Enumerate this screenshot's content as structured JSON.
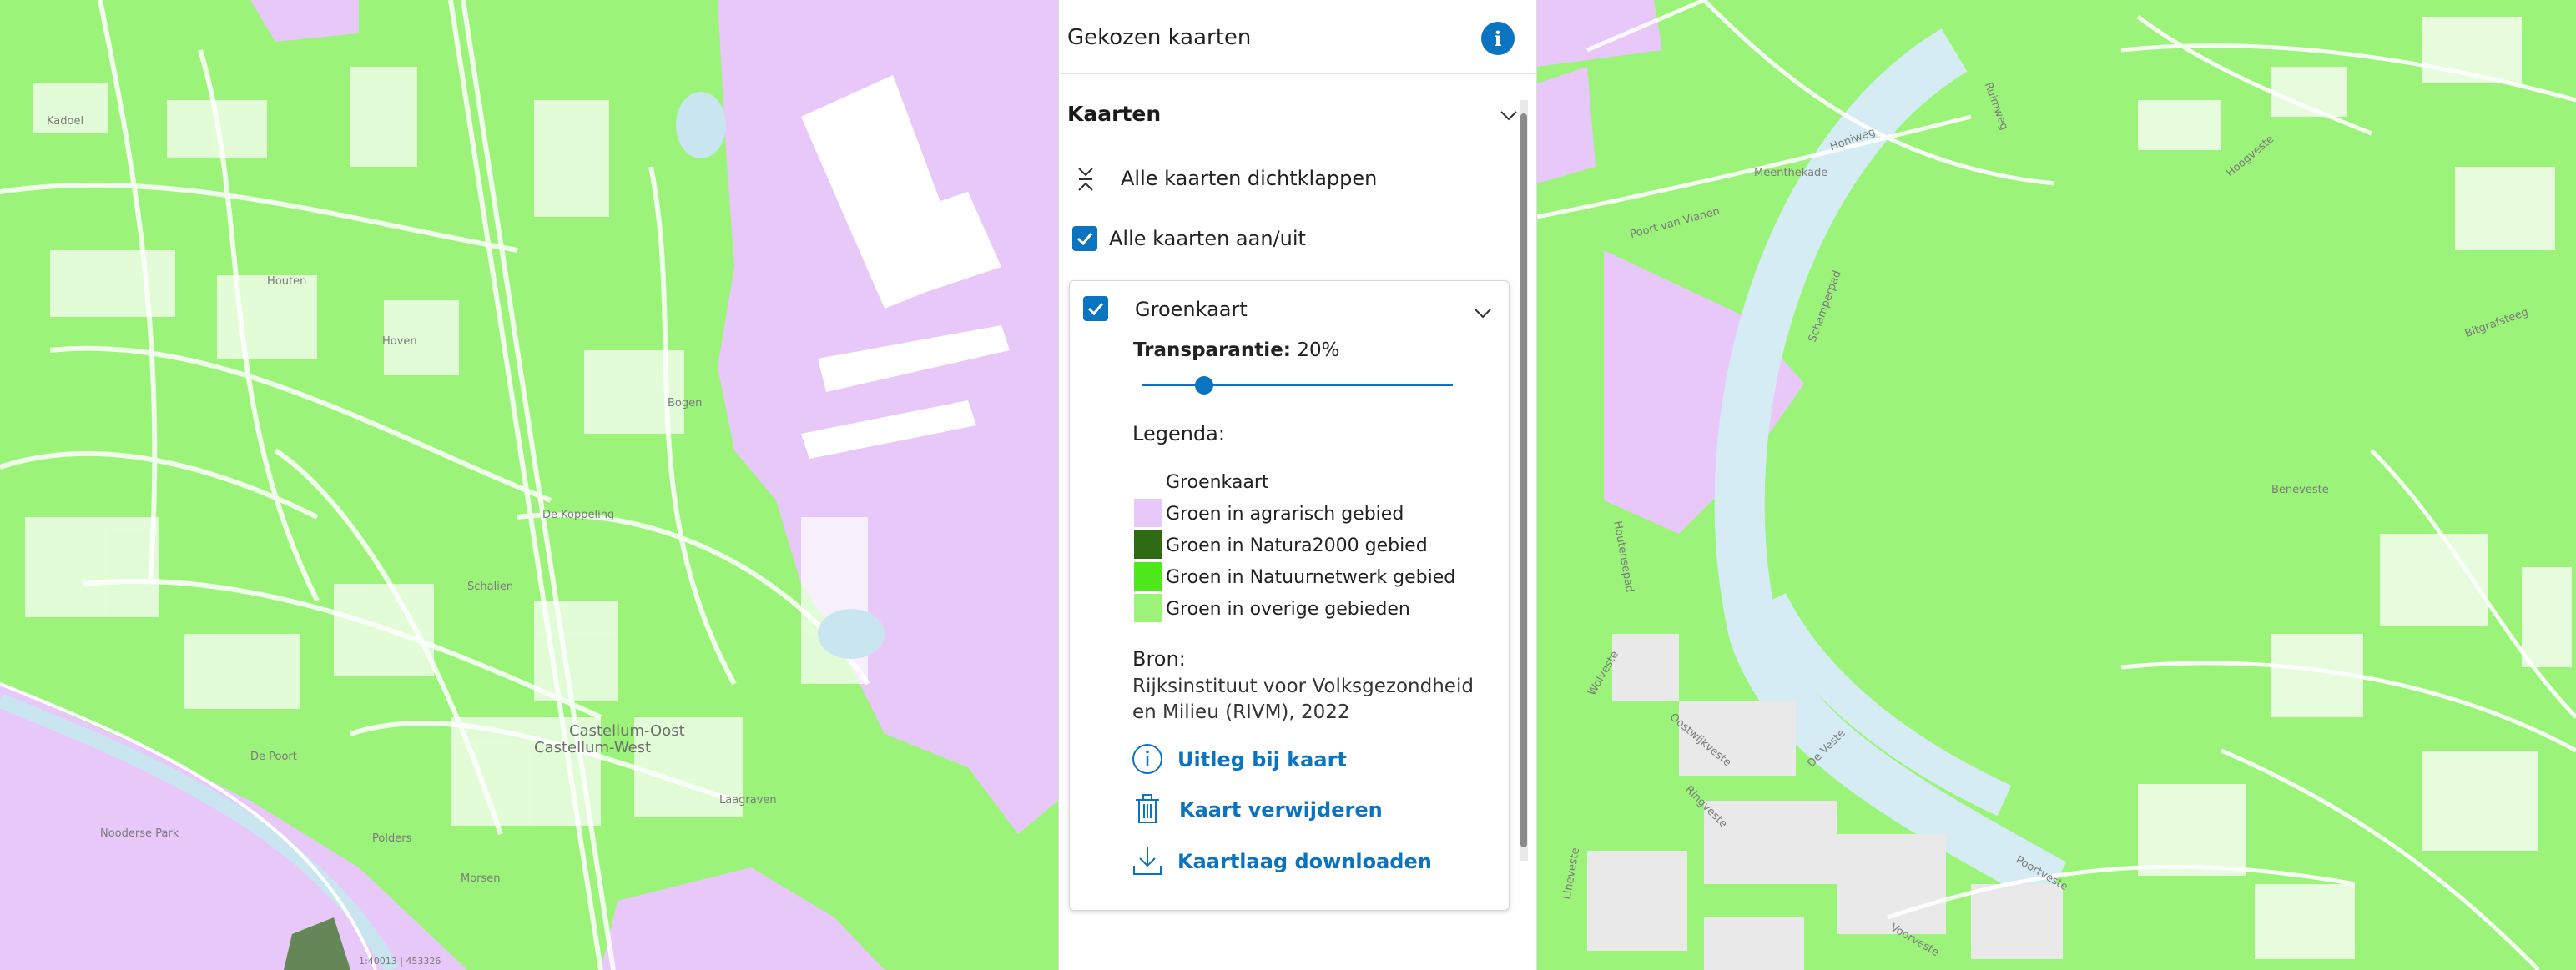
{
  "panel": {
    "title": "Gekozen kaarten",
    "info_icon": "info-icon",
    "section_title": "Kaarten",
    "collapse_all_label": "Alle kaarten dichtklappen",
    "toggle_all_label": "Alle kaarten aan/uit",
    "toggle_all_checked": true
  },
  "layer": {
    "name": "Groenkaart",
    "checked": true,
    "transparency_label": "Transparantie:",
    "transparency_value": "20%",
    "transparency_fraction": 0.2,
    "legend_title": "Legenda:",
    "legend": [
      {
        "label": "Groenkaart",
        "color": "#ffffff"
      },
      {
        "label": "Groen in agrarisch gebied",
        "color": "#e8c8f8"
      },
      {
        "label": "Groen in Natura2000 gebied",
        "color": "#2e6b12"
      },
      {
        "label": "Groen in Natuurnetwerk gebied",
        "color": "#4fe81c"
      },
      {
        "label": "Groen in overige gebieden",
        "color": "#9bf37a"
      }
    ],
    "source_label": "Bron:",
    "source_text": "Rijksinstituut voor Volksgezondheid en Milieu (RIVM), 2022",
    "actions": [
      {
        "label": "Uitleg bij kaart",
        "icon": "info-circle-icon"
      },
      {
        "label": "Kaart verwijderen",
        "icon": "trash-icon"
      },
      {
        "label": "Kaartlaag downloaden",
        "icon": "download-icon"
      }
    ]
  },
  "map_left": {
    "labels": [
      "Castellum-Oost",
      "Castellum-West",
      "Schalien",
      "Hoven",
      "Kadoel",
      "Polders",
      "Bogen",
      "Morsen",
      "Laagraven",
      "Houten",
      "De Koppeling",
      "Nooderse Park",
      "De Poort"
    ],
    "scale_text": "1:40013 | 453326"
  },
  "map_right": {
    "labels": [
      "De Veste",
      "Ringveste",
      "Voorveste",
      "Lineveste",
      "Wolveste",
      "Oostwijkveste",
      "Houtensepad",
      "Schamperpad",
      "Poortveste",
      "Ruimweg",
      "Honiweg",
      "Hoogveste",
      "Bitgrafsteeg",
      "Beneveste",
      "Meenthekade",
      "Poort van Vianen"
    ],
    "area_color": "#c8f7b4",
    "area_border_color": "#2f8fd6"
  }
}
